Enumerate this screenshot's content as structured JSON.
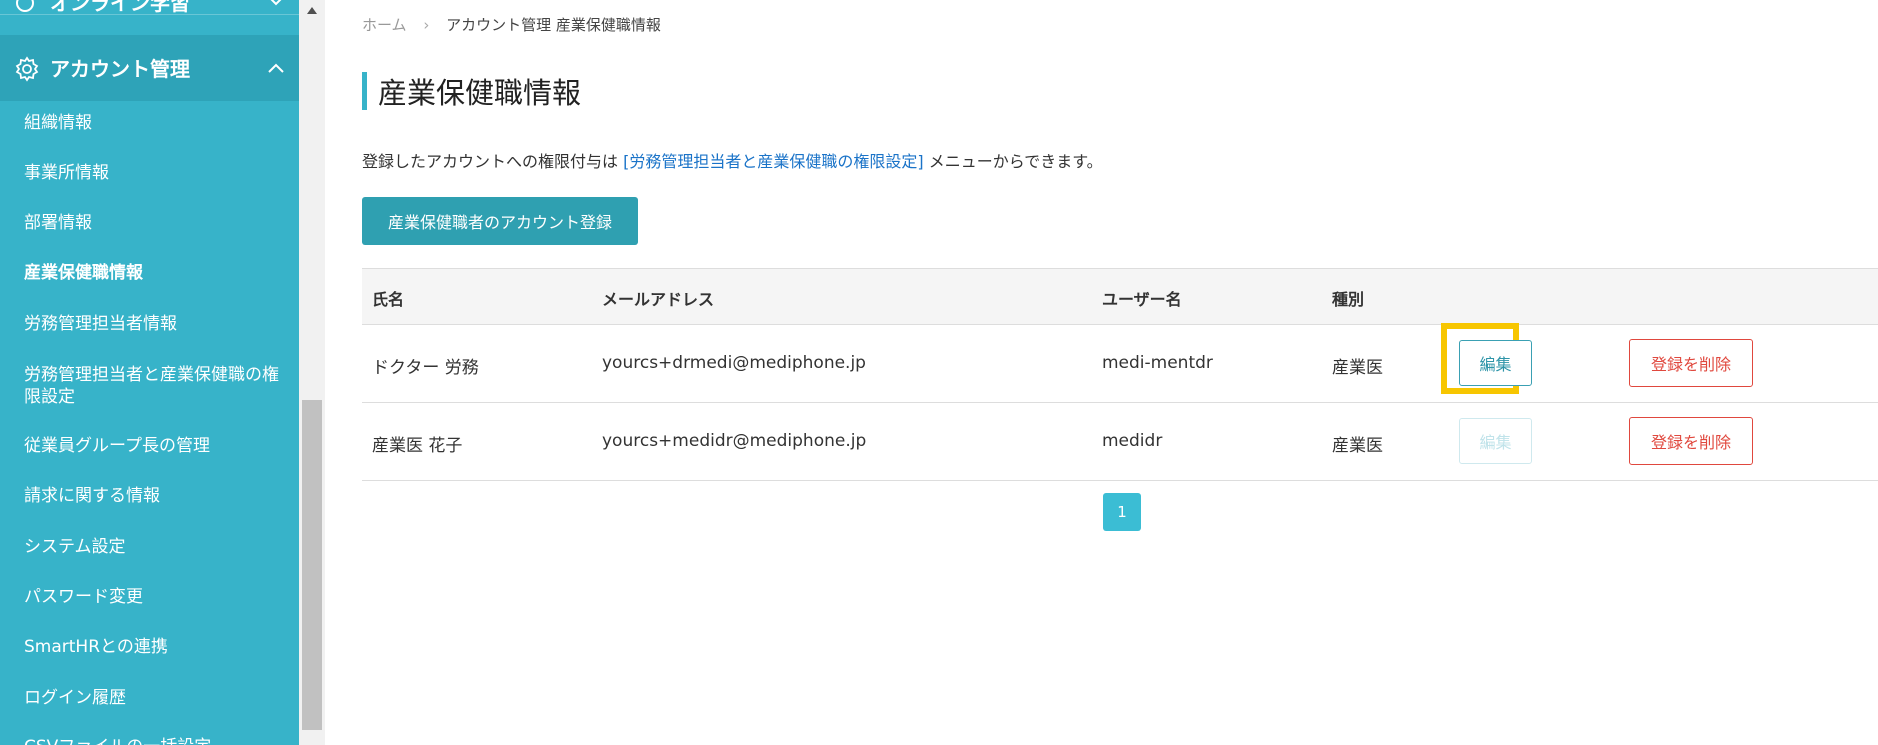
{
  "sidebar": {
    "previous_section_label": "オンライン学習",
    "section": {
      "label": "アカウント管理",
      "icon": "gear-icon"
    },
    "items": [
      {
        "label": "組織情報",
        "active": false
      },
      {
        "label": "事業所情報",
        "active": false
      },
      {
        "label": "部署情報",
        "active": false
      },
      {
        "label": "産業保健職情報",
        "active": true
      },
      {
        "label": "労務管理担当者情報",
        "active": false
      },
      {
        "label": "労務管理担当者と産業保健職の権限設定",
        "active": false
      },
      {
        "label": "従業員グループ長の管理",
        "active": false
      },
      {
        "label": "請求に関する情報",
        "active": false
      },
      {
        "label": "システム設定",
        "active": false
      },
      {
        "label": "パスワード変更",
        "active": false
      },
      {
        "label": "SmartHRとの連携",
        "active": false
      },
      {
        "label": "ログイン履歴",
        "active": false
      },
      {
        "label": "CSVファイルの一括設定",
        "active": false
      }
    ]
  },
  "breadcrumb": {
    "home": "ホーム",
    "separator": "›",
    "current": "アカウント管理 産業保健職情報"
  },
  "page": {
    "title": "産業保健職情報",
    "notice_prefix": "登録したアカウントへの権限付与は",
    "notice_link": "[労務管理担当者と産業保健職の権限設定]",
    "notice_suffix": "メニューからできます。",
    "register_button": "産業保健職者のアカウント登録"
  },
  "table": {
    "headers": {
      "name": "氏名",
      "email": "メールアドレス",
      "username": "ユーザー名",
      "type": "種別"
    },
    "rows": [
      {
        "name": "ドクター 労務",
        "email": "yourcs+drmedi@mediphone.jp",
        "username": "medi-mentdr",
        "type": "産業医",
        "edit": "編集",
        "edit_enabled": true,
        "delete": "登録を削除"
      },
      {
        "name": "産業医 花子",
        "email": "yourcs+medidr@mediphone.jp",
        "username": "medidr",
        "type": "産業医",
        "edit": "編集",
        "edit_enabled": false,
        "delete": "登録を削除"
      }
    ]
  },
  "pagination": {
    "current_page": "1"
  },
  "colors": {
    "sidebar": "#37b3c9",
    "sidebar_section": "#2ea3b8",
    "primary_button": "#2fa0b1",
    "highlight": "#f7c600",
    "danger": "#e0483e",
    "link": "#1a73c8"
  }
}
